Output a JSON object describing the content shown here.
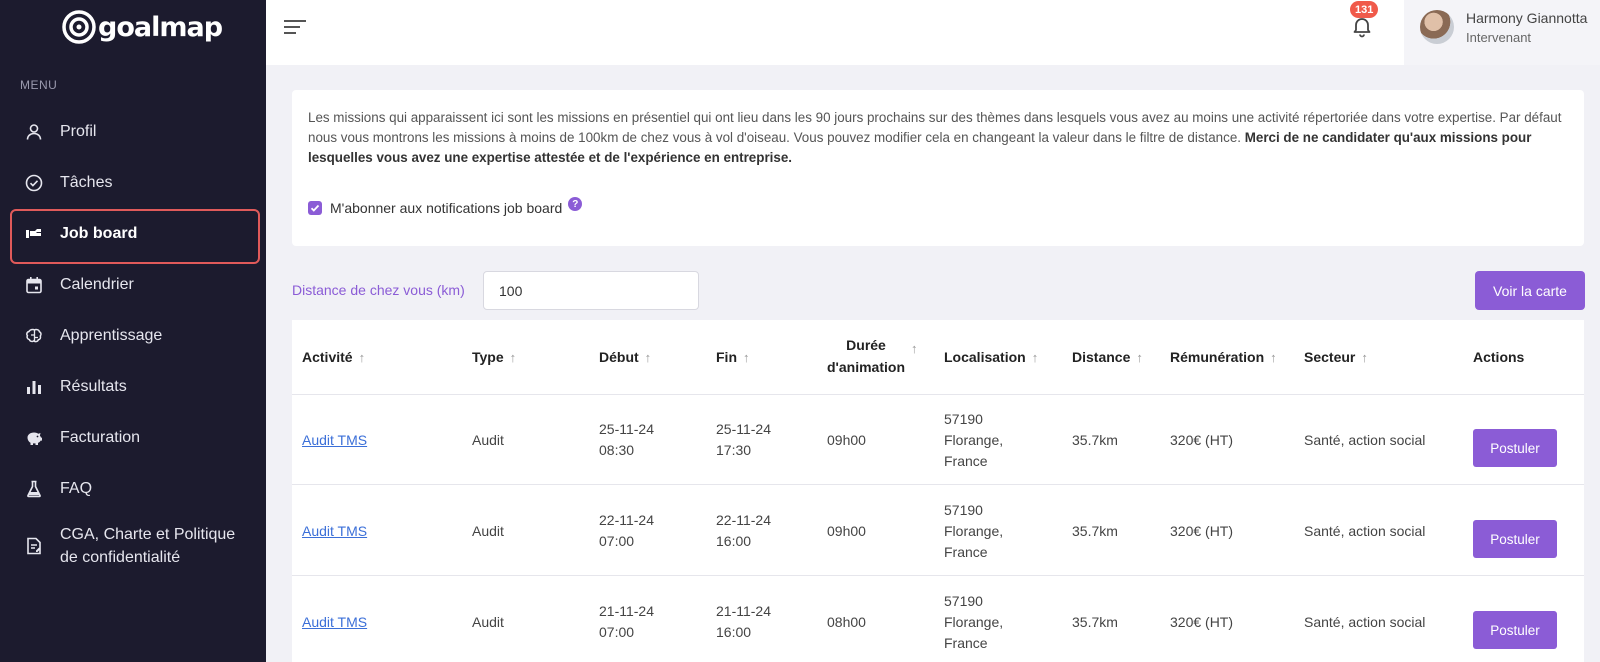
{
  "app": {
    "logo": "goalmap",
    "menu_label": "MENU"
  },
  "sidebar": {
    "items": [
      {
        "label": "Profil",
        "icon": "user-icon",
        "active": false
      },
      {
        "label": "Tâches",
        "icon": "check-circle-icon",
        "active": false
      },
      {
        "label": "Job board",
        "icon": "job-board-icon",
        "active": true
      },
      {
        "label": "Calendrier",
        "icon": "calendar-icon",
        "active": false
      },
      {
        "label": "Apprentissage",
        "icon": "brain-icon",
        "active": false
      },
      {
        "label": "Résultats",
        "icon": "bar-chart-icon",
        "active": false
      },
      {
        "label": "Facturation",
        "icon": "piggy-bank-icon",
        "active": false
      },
      {
        "label": "FAQ",
        "icon": "flask-icon",
        "active": false
      },
      {
        "label": "CGA, Charte et Politique de confidentialité",
        "icon": "document-icon",
        "active": false
      }
    ]
  },
  "topbar": {
    "notification_count": "131",
    "user_name": "Harmony Giannotta",
    "user_role": "Intervenant"
  },
  "info": {
    "text": "Les missions qui apparaissent ici sont les missions en présentiel qui ont lieu dans les 90 jours prochains sur des thèmes dans lesquels vous avez au moins une activité répertoriée dans votre expertise. Par défaut nous vous montrons les missions à moins de 100km de chez vous à vol d'oiseau. Vous pouvez modifier cela en changeant la valeur dans le filtre de distance.",
    "bold_text": "Merci de ne candidater qu'aux missions pour lesquelles vous avez une expertise attestée et de l'expérience en entreprise.",
    "subscribe_label": "M'abonner aux notifications job board",
    "subscribe_checked": true,
    "help": "?"
  },
  "filter": {
    "label": "Distance de chez vous (km)",
    "value": "100",
    "map_button": "Voir la carte"
  },
  "table": {
    "headers": {
      "activity": "Activité",
      "type": "Type",
      "start": "Début",
      "end": "Fin",
      "duration_line1": "Durée",
      "duration_line2": "d'animation",
      "location": "Localisation",
      "distance": "Distance",
      "pay": "Rémunération",
      "sector": "Secteur",
      "actions": "Actions"
    },
    "rows": [
      {
        "activity": "Audit TMS",
        "type": "Audit",
        "start_date": "25-11-24",
        "start_time": "08:30",
        "end_date": "25-11-24",
        "end_time": "17:30",
        "duration": "09h00",
        "loc1": "57190",
        "loc2": "Florange,",
        "loc3": "France",
        "distance": "35.7km",
        "pay": "320€ (HT)",
        "sector": "Santé, action social",
        "action": "Postuler"
      },
      {
        "activity": "Audit TMS",
        "type": "Audit",
        "start_date": "22-11-24",
        "start_time": "07:00",
        "end_date": "22-11-24",
        "end_time": "16:00",
        "duration": "09h00",
        "loc1": "57190",
        "loc2": "Florange,",
        "loc3": "France",
        "distance": "35.7km",
        "pay": "320€ (HT)",
        "sector": "Santé, action social",
        "action": "Postuler"
      },
      {
        "activity": "Audit TMS",
        "type": "Audit",
        "start_date": "21-11-24",
        "start_time": "07:00",
        "end_date": "21-11-24",
        "end_time": "16:00",
        "duration": "08h00",
        "loc1": "57190",
        "loc2": "Florange,",
        "loc3": "France",
        "distance": "35.7km",
        "pay": "320€ (HT)",
        "sector": "Santé, action social",
        "action": "Postuler"
      }
    ]
  },
  "colors": {
    "sidebar_bg": "#1c1b2e",
    "accent": "#8b5cd6",
    "active_outline": "#e05a5a",
    "badge": "#f05a4a",
    "link": "#3b6fd8"
  }
}
